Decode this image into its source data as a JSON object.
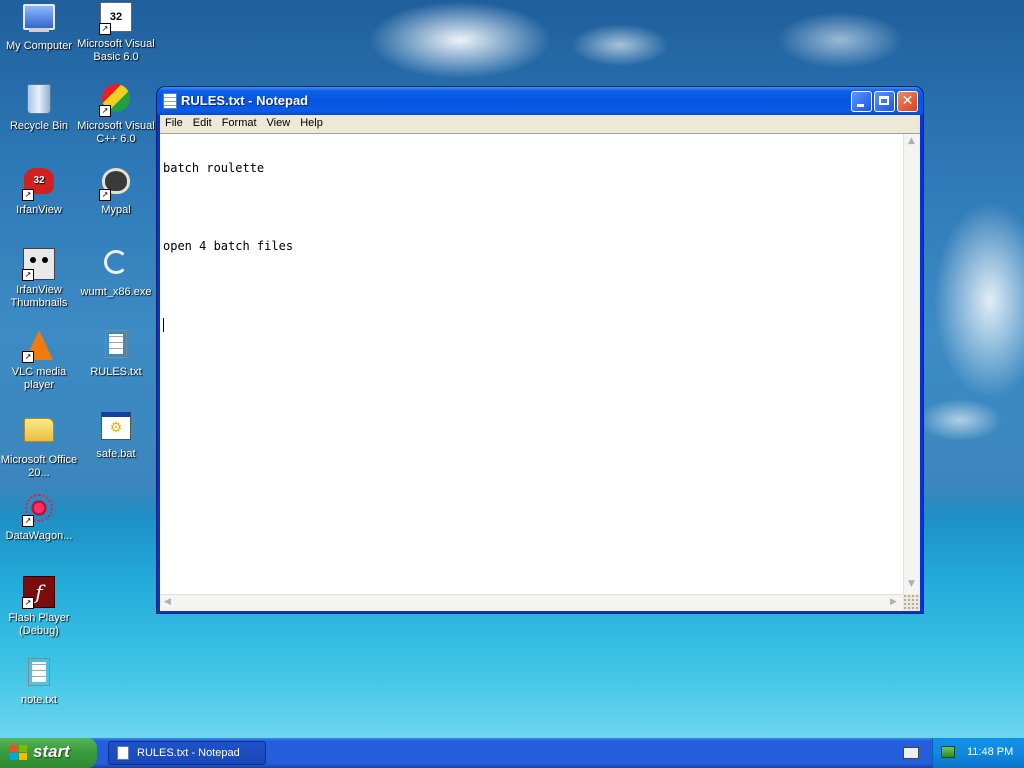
{
  "desktop": {
    "icons": [
      {
        "label": "My Computer"
      },
      {
        "label": "Microsoft Visual Basic 6.0"
      },
      {
        "label": "Recycle Bin"
      },
      {
        "label": "Microsoft Visual C++ 6.0"
      },
      {
        "label": "IrfanView"
      },
      {
        "label": "Mypal"
      },
      {
        "label": "IrfanView Thumbnails"
      },
      {
        "label": "wumt_x86.exe"
      },
      {
        "label": "VLC media player"
      },
      {
        "label": "RULES.txt"
      },
      {
        "label": "Microsoft Office 20..."
      },
      {
        "label": "safe.bat"
      },
      {
        "label": "DataWagon..."
      },
      {
        "label": "Flash Player (Debug)"
      },
      {
        "label": "note.txt"
      }
    ]
  },
  "window": {
    "title": "RULES.txt - Notepad",
    "menu": [
      "File",
      "Edit",
      "Format",
      "View",
      "Help"
    ],
    "content_lines": [
      "batch roulette",
      "",
      "open 4 batch files",
      ""
    ]
  },
  "taskbar": {
    "start_label": "start",
    "task_button_label": "RULES.txt - Notepad",
    "clock": "11:48 PM"
  }
}
